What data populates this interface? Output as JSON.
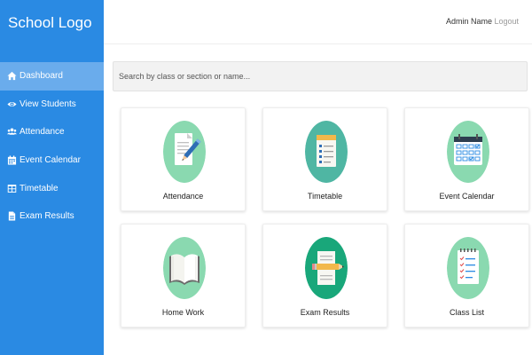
{
  "sidebar": {
    "logo": "School Logo",
    "items": [
      {
        "label": "Dashboard"
      },
      {
        "label": "View Students"
      },
      {
        "label": "Attendance"
      },
      {
        "label": "Event Calendar"
      },
      {
        "label": "Timetable"
      },
      {
        "label": "Exam Results"
      }
    ]
  },
  "header": {
    "admin_name": "Admin Name",
    "logout": "Logout"
  },
  "search": {
    "placeholder": "Search by class or section or name..."
  },
  "cards": [
    {
      "label": "Attendance",
      "icon": "document-pencil-icon"
    },
    {
      "label": "Timetable",
      "icon": "checklist-icon"
    },
    {
      "label": "Event Calendar",
      "icon": "calendar-icon"
    },
    {
      "label": "Home Work",
      "icon": "open-book-icon"
    },
    {
      "label": "Exam Results",
      "icon": "exam-pencil-icon"
    },
    {
      "label": "Class List",
      "icon": "notepad-checklist-icon"
    }
  ],
  "colors": {
    "sidebar": "#2a8ae3",
    "sidebar_active": "#6aacec",
    "icon_circle_light": "#8ad9b0",
    "icon_circle_dark": "#19a77a"
  }
}
